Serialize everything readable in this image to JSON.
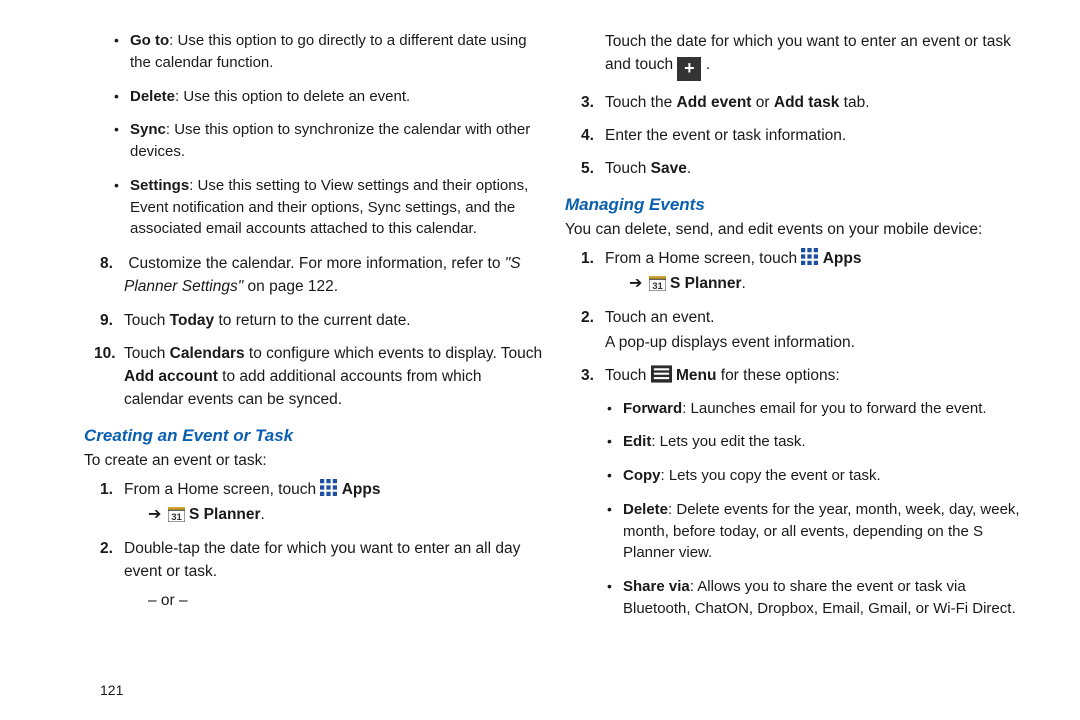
{
  "left": {
    "bullets": [
      {
        "term": "Go to",
        "desc": ": Use this option to go directly to a different date using the calendar function."
      },
      {
        "term": "Delete",
        "desc": ": Use this option to delete an event."
      },
      {
        "term": "Sync",
        "desc": ": Use this option to synchronize the calendar with other devices."
      },
      {
        "term": "Settings",
        "desc": ": Use this setting to View settings and their options, Event notification and their options, Sync settings, and the associated email accounts attached to this calendar."
      }
    ],
    "step8_num": "8.",
    "step8_a": "Customize the calendar. For more information, refer to ",
    "step8_ref": "\"S Planner Settings\"",
    "step8_b": " on page 122.",
    "step9_num": "9.",
    "step9_a": "Touch ",
    "step9_today": "Today",
    "step9_b": " to return to the current date.",
    "step10_num": "10.",
    "step10_a": "Touch ",
    "step10_cal": "Calendars",
    "step10_b": " to configure which events to display. Touch ",
    "step10_add": "Add account",
    "step10_c": " to add additional accounts from which calendar events can be synced.",
    "createHead": "Creating an Event or Task",
    "createIntro": "To create an event or task:",
    "c1_num": "1.",
    "c1_a": "From a Home screen, touch ",
    "c1_apps": "Apps",
    "c1_sp": "S Planner",
    "c1_dot": ".",
    "c2_num": "2.",
    "c2": "Double-tap the date for which you want to enter an all day event or task.",
    "or": "– or –"
  },
  "right": {
    "r2a": "Touch the date for which you want to enter an event or task and touch ",
    "r2b": ".",
    "r3_num": "3.",
    "r3_a": "Touch the ",
    "r3_ae": "Add event",
    "r3_or": " or ",
    "r3_at": "Add task",
    "r3_b": "  tab.",
    "r4_num": "4.",
    "r4": "Enter the event or task information.",
    "r5_num": "5.",
    "r5_a": "Touch ",
    "r5_save": "Save",
    "r5_b": ".",
    "manageHead": "Managing Events",
    "manageIntro": "You can delete, send, and edit events on your mobile device:",
    "m1_num": "1.",
    "m1_a": "From a Home screen, touch ",
    "m1_apps": "Apps",
    "m1_sp": "S Planner",
    "m1_dot": ".",
    "m2_num": "2.",
    "m2_a": "Touch an event.",
    "m2_b": "A pop-up displays event information.",
    "m3_num": "3.",
    "m3_a": "Touch ",
    "m3_menu": "Menu",
    "m3_b": " for these options:",
    "m_bullets": [
      {
        "term": "Forward",
        "desc": ": Launches email for you to forward the event."
      },
      {
        "term": "Edit",
        "desc": ": Lets you edit the task."
      },
      {
        "term": "Copy",
        "desc": ": Lets you copy the event or task."
      },
      {
        "term": "Delete",
        "desc": ": Delete events for the year, month, week, day, week, month, before today, or all events, depending on the S Planner view."
      },
      {
        "term": "Share via",
        "desc": ": Allows you to share the event or task via Bluetooth, ChatON, Dropbox, Email, Gmail, or Wi-Fi Direct."
      }
    ]
  },
  "pageNumber": "121"
}
